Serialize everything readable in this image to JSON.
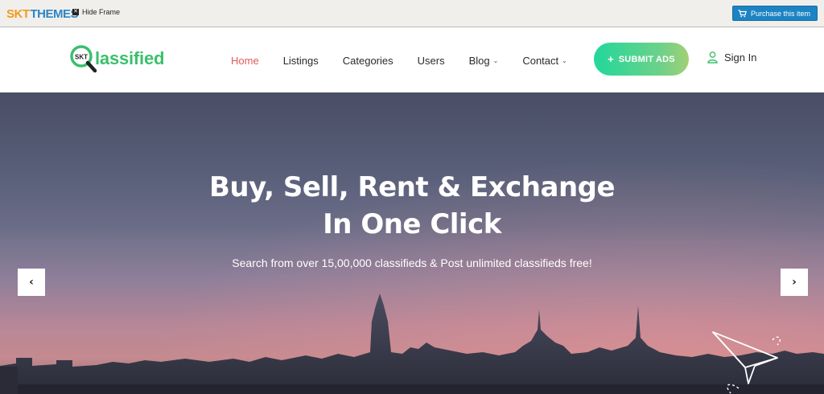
{
  "frame": {
    "logo_part1": "SKT",
    "logo_part2": "THEMES",
    "hide_frame_label": "Hide Frame",
    "purchase_label": "Purchase this item"
  },
  "brand": {
    "badge_text": "SKT",
    "word": "lassified"
  },
  "nav": {
    "items": [
      {
        "label": "Home",
        "active": true
      },
      {
        "label": "Listings"
      },
      {
        "label": "Categories"
      },
      {
        "label": "Users"
      },
      {
        "label": "Blog",
        "dropdown": true
      },
      {
        "label": "Contact",
        "dropdown": true
      }
    ]
  },
  "header": {
    "submit_label": "SUBMIT ADS",
    "submit_icon": "+",
    "sign_in_label": "Sign In"
  },
  "hero": {
    "title_line1": "Buy, Sell, Rent & Exchange",
    "title_line2": "In One Click",
    "subtitle": "Search from over 15,00,000 classifieds & Post unlimited classifieds free!",
    "prev_arrow": "‹",
    "next_arrow": "›"
  },
  "colors": {
    "accent_green": "#3cbf6e",
    "active_nav": "#e05a5a",
    "purchase_blue": "#1d84c4"
  }
}
